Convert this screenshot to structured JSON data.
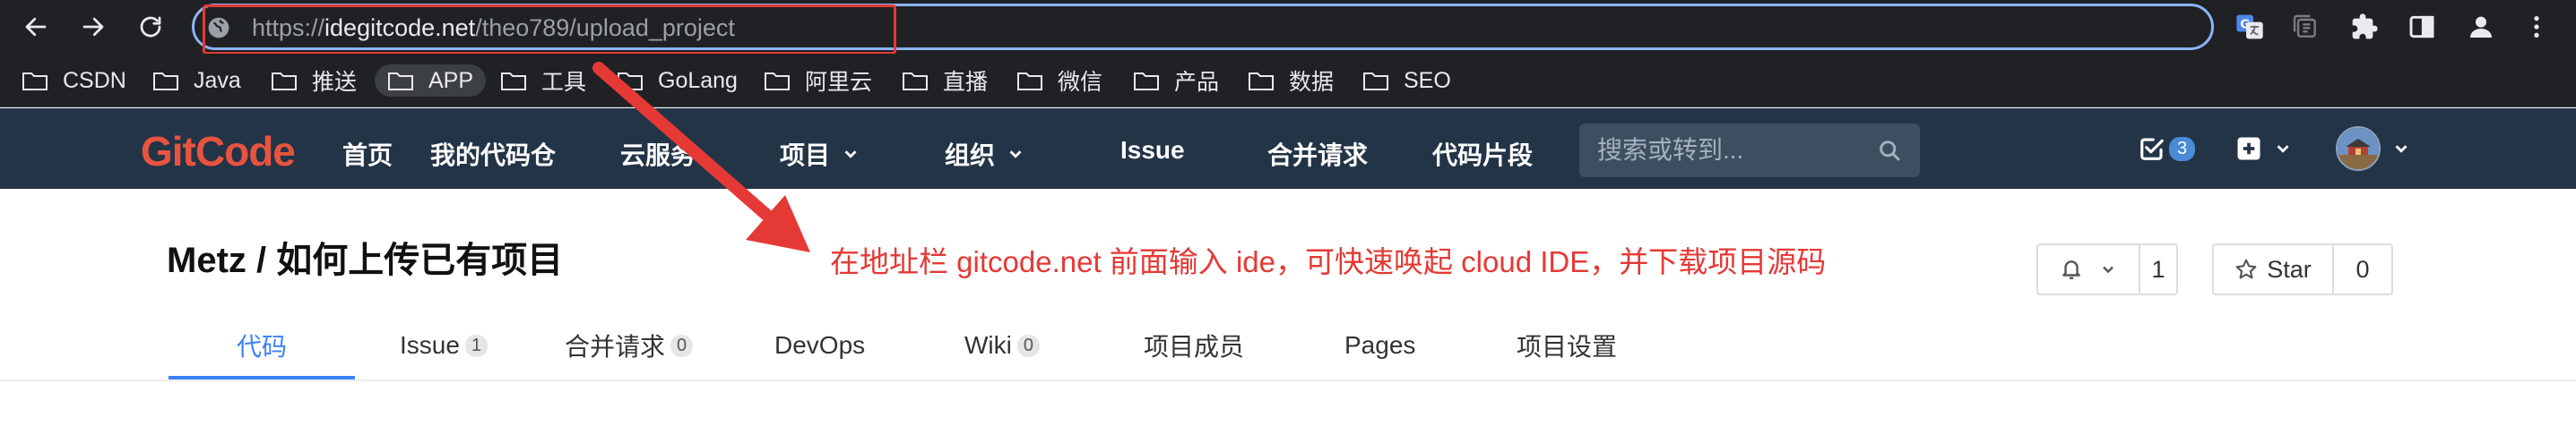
{
  "browser": {
    "url": {
      "scheme": "https://",
      "host": "idegitcode.net",
      "path": "/theo789/upload_project"
    },
    "bookmarks": [
      "CSDN",
      "Java",
      "推送",
      "APP",
      "工具",
      "GoLang",
      "阿里云",
      "直播",
      "微信",
      "产品",
      "数据",
      "SEO"
    ],
    "icons": {
      "back": "back-arrow-icon",
      "forward": "forward-arrow-icon",
      "reload": "reload-icon",
      "translate": "translate-icon",
      "tab_search": "tab-search-icon",
      "extensions": "puzzle-icon",
      "side_panel": "side-panel-icon",
      "profile": "profile-icon",
      "menu": "kebab-menu-icon"
    },
    "annotation_color": "#e53935"
  },
  "header": {
    "logo": "GitCode",
    "nav": [
      "首页",
      "我的代码仓",
      "云服务",
      "项目",
      "组织",
      "Issue",
      "合并请求",
      "代码片段"
    ],
    "search_placeholder": "搜索或转到...",
    "todo_count": "3",
    "colors": {
      "background": "#243447",
      "logo": "#e8533f",
      "accent": "#4a8ad6"
    }
  },
  "project": {
    "title": "Metz / 如何上传已有项目",
    "annotation": "在地址栏 gitcode.net 前面输入 ide，可快速唤起 cloud IDE，并下载项目源码",
    "watch_count": "1",
    "star_label": "Star",
    "star_count": "0"
  },
  "tabs": [
    {
      "label": "代码",
      "count": null,
      "active": true
    },
    {
      "label": "Issue",
      "count": "1"
    },
    {
      "label": "合并请求",
      "count": "0"
    },
    {
      "label": "DevOps",
      "count": null
    },
    {
      "label": "Wiki",
      "count": "0"
    },
    {
      "label": "项目成员",
      "count": null
    },
    {
      "label": "Pages",
      "count": null
    },
    {
      "label": "项目设置",
      "count": null
    }
  ],
  "tab_accent": "#3b82f6"
}
